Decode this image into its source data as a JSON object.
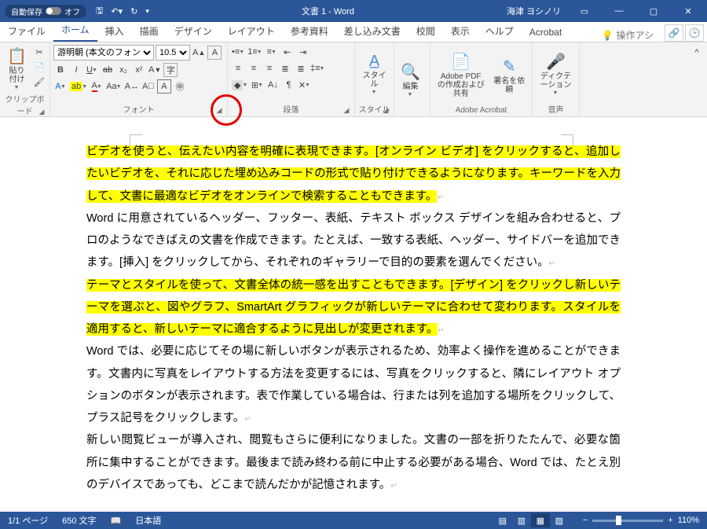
{
  "titlebar": {
    "autosave": "自動保存",
    "autosave_state": "オフ",
    "doc_title": "文書 1 - Word",
    "username": "海津 ヨシノリ"
  },
  "tabs": {
    "items": [
      "ファイル",
      "ホーム",
      "挿入",
      "描画",
      "デザイン",
      "レイアウト",
      "参考資料",
      "差し込み文書",
      "校閲",
      "表示",
      "ヘルプ",
      "Acrobat"
    ],
    "active": 1,
    "tellme": "操作アシ"
  },
  "ribbon": {
    "clipboard": {
      "paste": "貼り付け",
      "label": "クリップボード"
    },
    "font": {
      "name": "游明朝 (本文のフォント)",
      "size": "10.5",
      "label": "フォント"
    },
    "paragraph": {
      "label": "段落"
    },
    "styles": {
      "btn": "スタイル",
      "label": "スタイル"
    },
    "editing": {
      "btn": "編集"
    },
    "acrobat": {
      "pdf": "Adobe PDF の作成および共有",
      "sign": "署名を依頼",
      "label": "Adobe Acrobat"
    },
    "dictate": {
      "btn": "ディクテーション",
      "label": "音声"
    }
  },
  "document": {
    "p1": "ビデオを使うと、伝えたい内容を明確に表現できます。[オンライン ビデオ] をクリックすると、追加したいビデオを、それに応じた埋め込みコードの形式で貼り付けできるようになります。キーワードを入力して、文書に最適なビデオをオンラインで検索することもできます。",
    "p2": "Word に用意されているヘッダー、フッター、表紙、テキスト ボックス デザインを組み合わせると、プロのようなできばえの文書を作成できます。たとえば、一致する表紙、ヘッダー、サイドバーを追加できます。[挿入] をクリックしてから、それぞれのギャラリーで目的の要素を選んでください。",
    "p3": "テーマとスタイルを使って、文書全体の統一感を出すこともできます。[デザイン] をクリックし新しいテーマを選ぶと、図やグラフ、SmartArt グラフィックが新しいテーマに合わせて変わります。スタイルを適用すると、新しいテーマに適合するように見出しが変更されます。",
    "p4": "Word では、必要に応じてその場に新しいボタンが表示されるため、効率よく操作を進めることができます。文書内に写真をレイアウトする方法を変更するには、写真をクリックすると、隣にレイアウト オプションのボタンが表示されます。表で作業している場合は、行または列を追加する場所をクリックして、プラス記号をクリックします。",
    "p5": "新しい閲覧ビューが導入され、閲覧もさらに便利になりました。文書の一部を折りたたんで、必要な箇所に集中することができます。最後まで読み終わる前に中止する必要がある場合、Word では、たとえ別のデバイスであっても、どこまで読んだかが記憶されます。"
  },
  "statusbar": {
    "page": "1/1 ページ",
    "words": "650 文字",
    "lang": "日本語",
    "zoom": "110%"
  }
}
